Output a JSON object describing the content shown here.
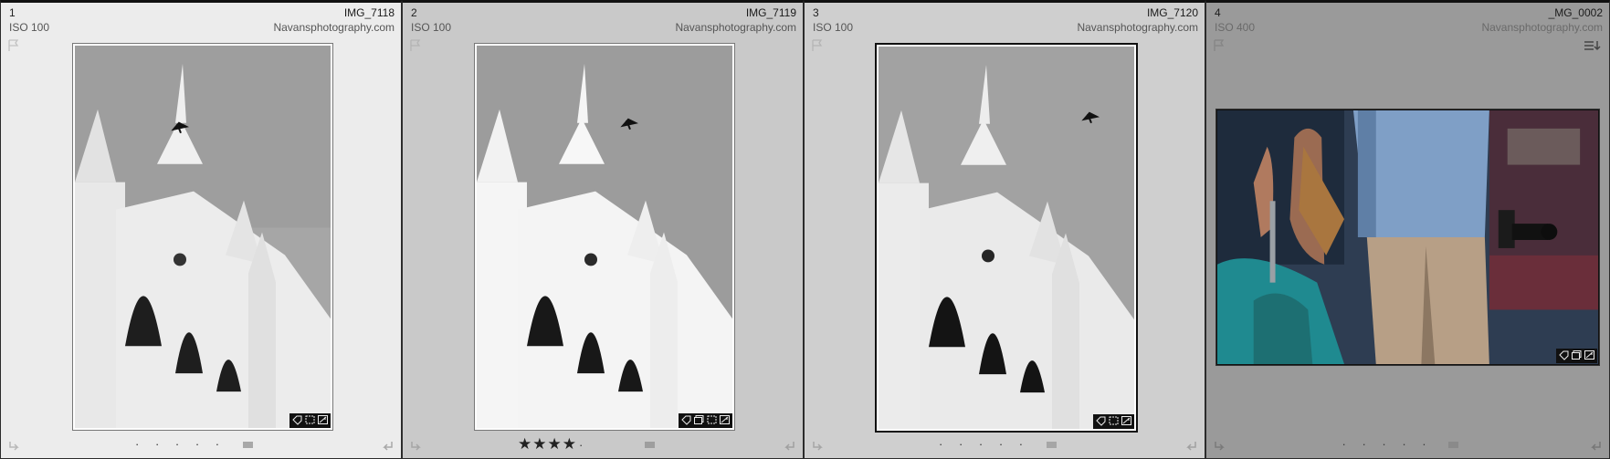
{
  "cells": [
    {
      "index": "1",
      "iso": "ISO 100",
      "filename": "IMG_7118",
      "watermark": "Navansphotography.com",
      "rating": "· · · · ·"
    },
    {
      "index": "2",
      "iso": "ISO 100",
      "filename": "IMG_7119",
      "watermark": "Navansphotography.com",
      "stars": "★★★★",
      "rating": "·"
    },
    {
      "index": "3",
      "iso": "ISO 100",
      "filename": "IMG_7120",
      "watermark": "Navansphotography.com",
      "rating": "· · · · ·"
    },
    {
      "index": "4",
      "iso": "ISO 400",
      "filename": "_MG_0002",
      "watermark": "Navansphotography.com",
      "rating": "· · · · ·"
    }
  ],
  "icons": {
    "flag": "flag-icon",
    "rotate_left": "rotate-left-icon",
    "rotate_right": "rotate-right-icon",
    "keyword": "keyword-badge-icon",
    "crop": "crop-badge-icon",
    "develop": "develop-adjustment-badge-icon",
    "collection": "collection-badge-icon",
    "list": "metadata-list-icon"
  },
  "colors": {
    "cell1_bg": "#ececec",
    "cell2_bg": "#c9c9c9",
    "cell3_bg": "#cfcfcf",
    "cell4_bg": "#9a9a9a"
  }
}
